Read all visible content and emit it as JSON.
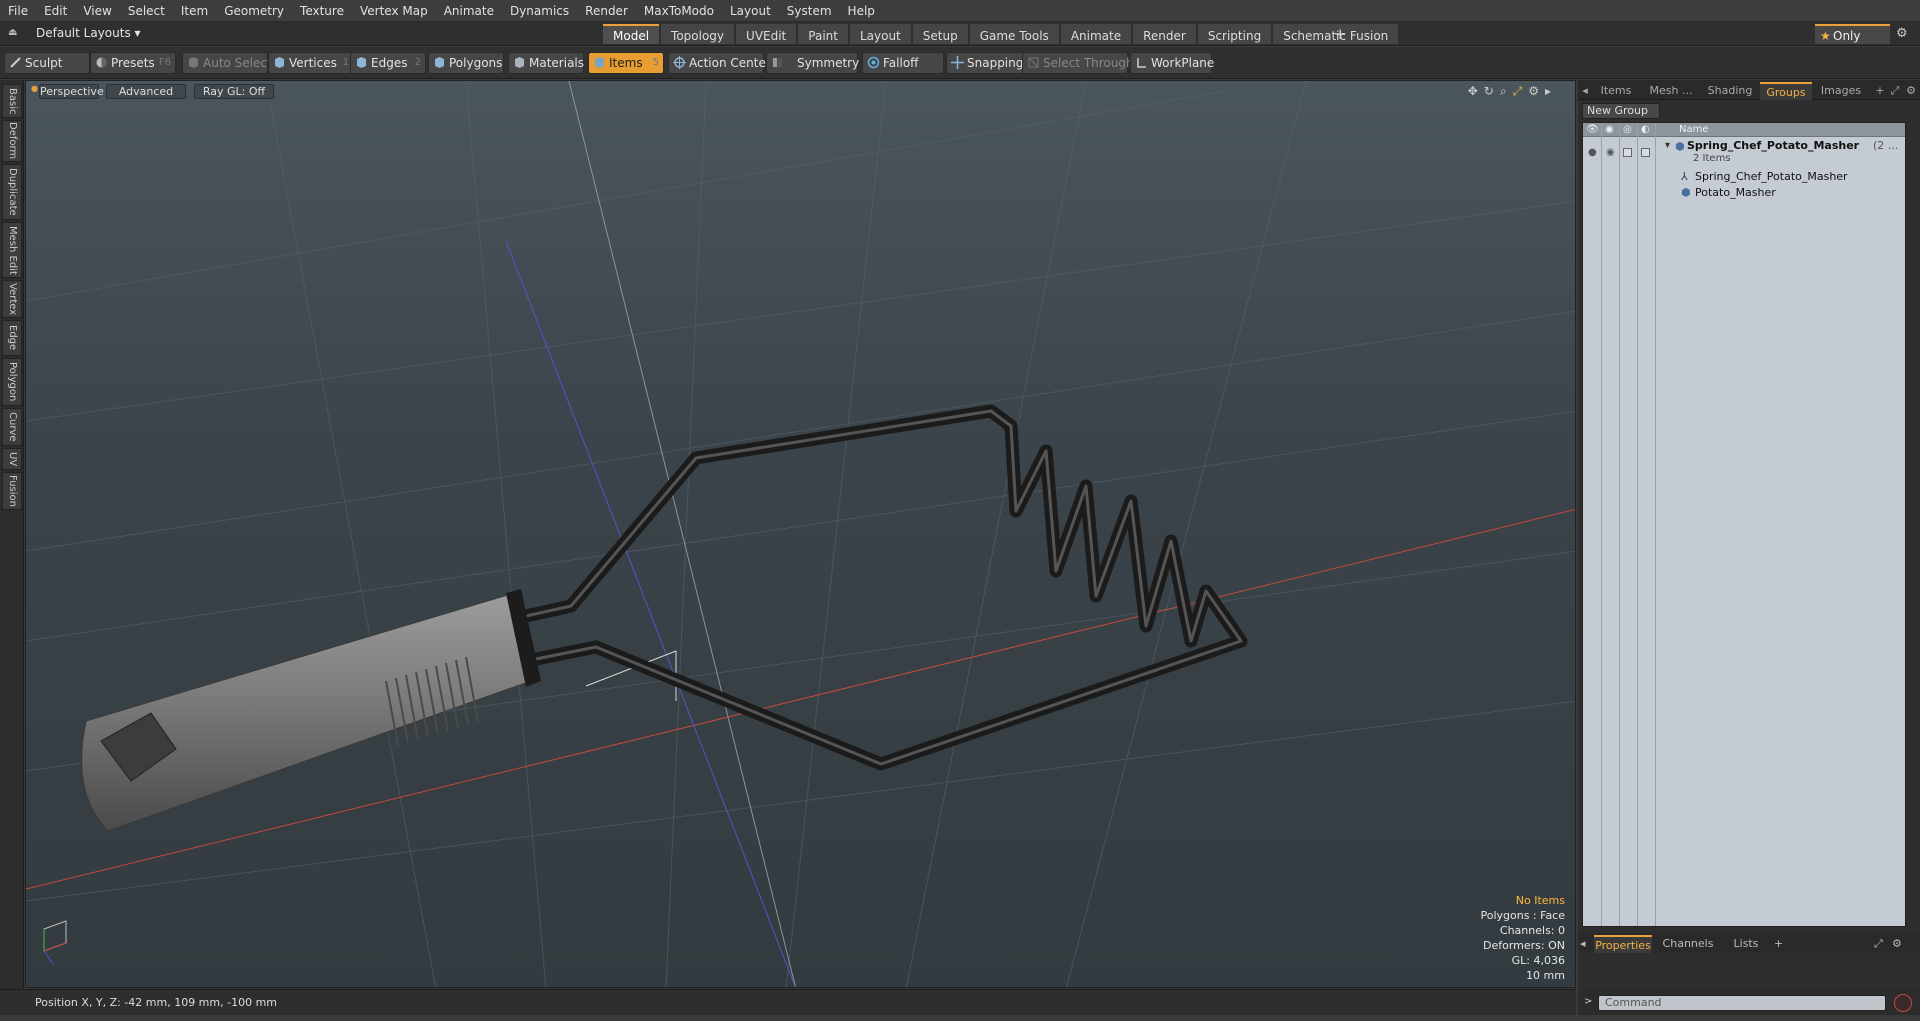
{
  "menu": [
    "File",
    "Edit",
    "View",
    "Select",
    "Item",
    "Geometry",
    "Texture",
    "Vertex Map",
    "Animate",
    "Dynamics",
    "Render",
    "MaxToModo",
    "Layout",
    "System",
    "Help"
  ],
  "layout_selector": "Default Layouts ▾",
  "layout_tabs": [
    "Model",
    "Topology",
    "UVEdit",
    "Paint",
    "Layout",
    "Setup",
    "Game Tools",
    "Animate",
    "Render",
    "Scripting",
    "Schematic Fusion"
  ],
  "active_layout_tab": "Model",
  "only_label": "Only",
  "toolbar": {
    "sculpt": "Sculpt",
    "presets": "Presets",
    "presets_shortcut": "F6",
    "auto_select": "Auto Select",
    "vertices": "Vertices",
    "vertices_count": "1",
    "edges": "Edges",
    "edges_count": "2",
    "polygons": "Polygons",
    "materials": "Materials",
    "items": "Items",
    "items_count": "5",
    "action_center": "Action Center",
    "symmetry": "Symmetry",
    "falloff": "Falloff",
    "snapping": "Snapping",
    "select_through": "Select Through",
    "workplane": "WorkPlane"
  },
  "left_tabs": [
    "Basic",
    "Deform",
    "Duplicate",
    "Mesh Edit",
    "Vertex",
    "Edge",
    "Polygon",
    "Curve",
    "UV",
    "Fusion"
  ],
  "viewport": {
    "perspective": "Perspective",
    "advanced": "Advanced",
    "raygl": "Ray GL: Off",
    "stats": {
      "no_items": "No Items",
      "polygons": "Polygons : Face",
      "channels": "Channels: 0",
      "deformers": "Deformers: ON",
      "gl": "GL: 4,036",
      "scale": "10 mm"
    }
  },
  "status": "Position X, Y, Z:  -42 mm, 109 mm, -100 mm",
  "right_panel": {
    "tabs": [
      "Items",
      "Mesh ...",
      "Shading",
      "Groups",
      "Images"
    ],
    "active_tab": "Groups",
    "new_group": "New Group",
    "name_header": "Name",
    "group_name": "Spring_Chef_Potato_Masher",
    "group_suffix": "(2 ...",
    "group_count": "2 Items",
    "children": [
      "Spring_Chef_Potato_Masher",
      "Potato_Masher"
    ],
    "bottom_tabs": [
      "Properties",
      "Channels",
      "Lists"
    ],
    "active_bottom_tab": "Properties",
    "command_placeholder": "Command"
  },
  "colors": {
    "accent": "#e9a23b",
    "viewport_top": "#4b555c",
    "viewport_bottom": "#333b40"
  }
}
